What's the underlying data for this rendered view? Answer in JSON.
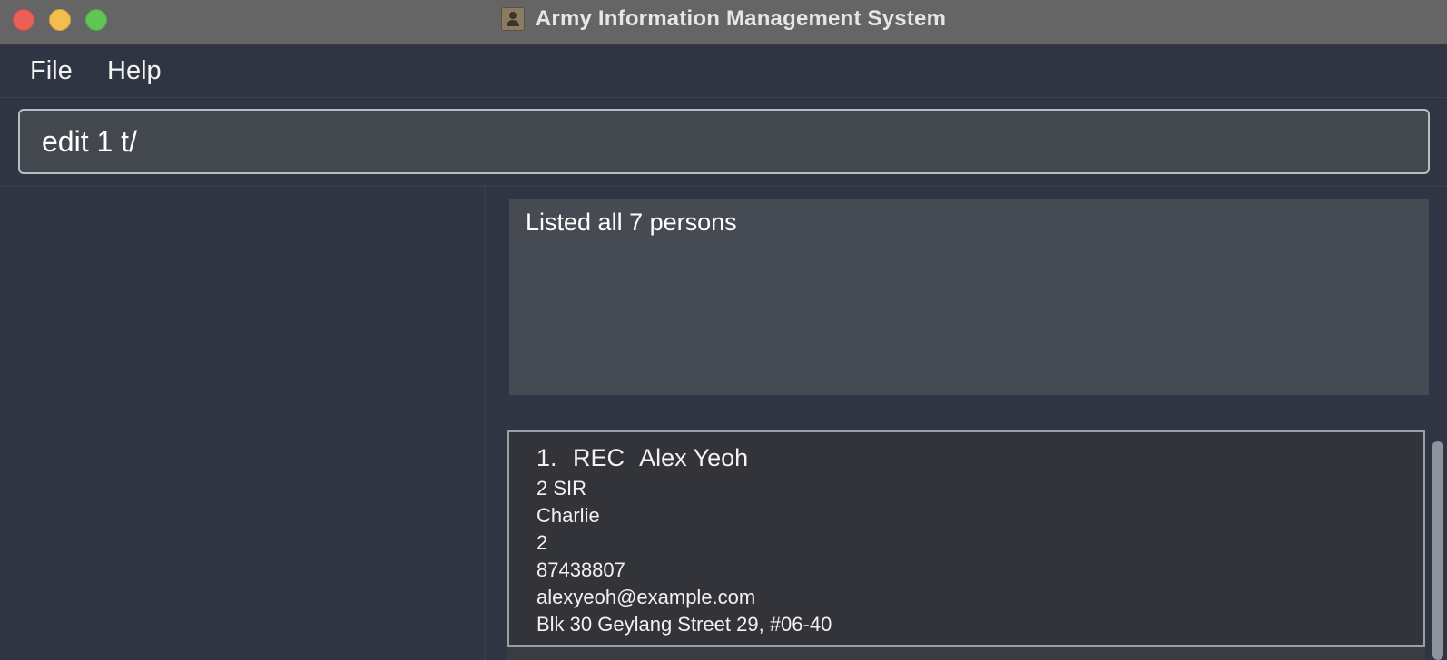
{
  "window": {
    "title": "Army Information Management System"
  },
  "menu": {
    "file": "File",
    "help": "Help"
  },
  "command": {
    "value": "edit 1 t/"
  },
  "result": {
    "message": "Listed all 7 persons"
  },
  "persons": [
    {
      "index": "1.",
      "rank": "REC",
      "name": "Alex Yeoh",
      "unit": "2 SIR",
      "company": "Charlie",
      "platoon": "2",
      "phone": "87438807",
      "email": "alexyeoh@example.com",
      "address": "Blk 30 Geylang Street 29, #06-40"
    }
  ],
  "colors": {
    "background": "#2f3542",
    "close": "#ec5f58",
    "minimize": "#f4be4f",
    "maximize": "#61c554"
  },
  "icons": {
    "app": "person-contact-icon"
  }
}
